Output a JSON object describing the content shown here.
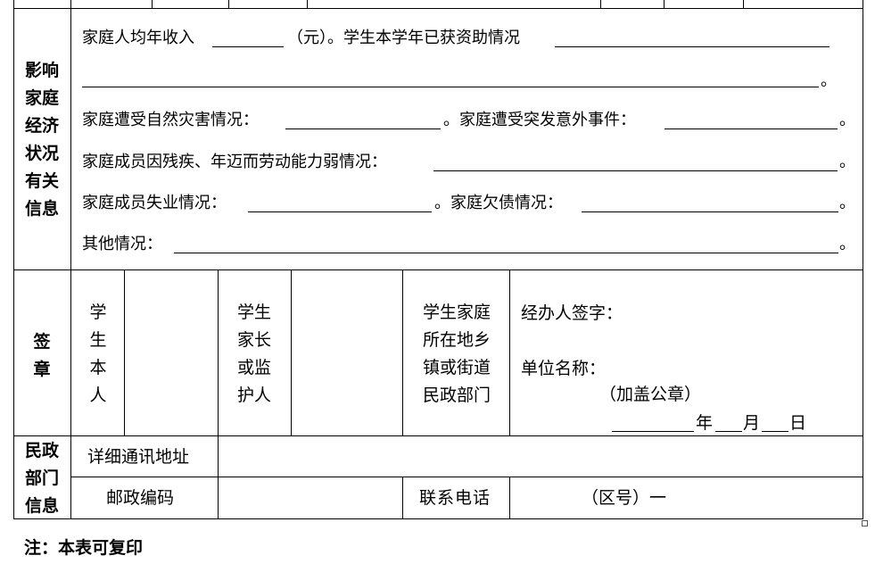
{
  "impact": {
    "label": "影响\n家庭\n经济\n状况\n有关\n信息",
    "l1a": "家庭人均年收入",
    "l1b": "（元）。学生本学年已获资助情况",
    "period": "。",
    "l3a": "家庭遭受自然灾害情况：",
    "l3b": "。家庭遭受突发意外事件：",
    "l4a": "家庭成员因残疾、年迈而劳动能力弱情况：",
    "l5a": "家庭成员失业情况：",
    "l5b": "。家庭欠债情况：",
    "l6a": "其他情况："
  },
  "sign": {
    "label": "签\n章",
    "student": "学\n生\n本\n人",
    "guardian": "学生\n家长\n或监\n护人",
    "dept": "学生家庭\n所在地乡\n镇或街道\n民政部门",
    "handler": "经办人签字：",
    "unit": "单位名称：",
    "seal": "（加盖公章）",
    "year": "年",
    "month": "月",
    "day": "日"
  },
  "civil": {
    "label": "民政\n部门\n信息",
    "address": "详细通讯地址",
    "postcode": "邮政编码",
    "phone": "联系电话",
    "area": "（区号）一"
  },
  "note": "注：本表可复印"
}
